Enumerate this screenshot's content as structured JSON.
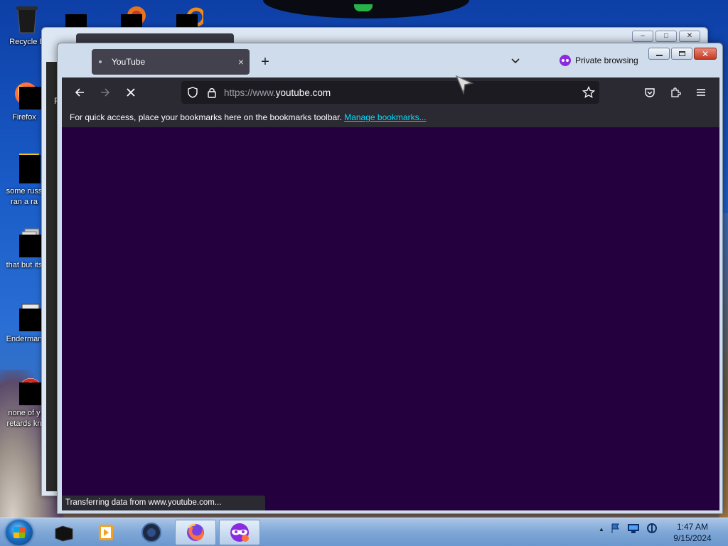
{
  "desktop": {
    "icons": [
      {
        "label": "Recycle B"
      },
      {
        "label": "Firefox"
      },
      {
        "label": "some russ\nran a ra"
      },
      {
        "label": "that but its"
      },
      {
        "label": "Enderman"
      },
      {
        "label": "none of y\nretards kn"
      }
    ],
    "back_window_char": "F"
  },
  "browser": {
    "tab": {
      "title": "YouTube",
      "close_glyph": "×"
    },
    "new_tab_glyph": "+",
    "private_label": "Private browsing",
    "url": {
      "prefix": "https://www.",
      "host": "youtube.com"
    },
    "bookmarks_bar": {
      "text": "For quick access, place your bookmarks here on the bookmarks toolbar.",
      "link": "Manage bookmarks..."
    },
    "status": "Transferring data from www.youtube.com..."
  },
  "taskbar": {
    "time": "1:47 AM",
    "date": "9/15/2024",
    "tray_arrow": "▲"
  },
  "colors": {
    "content_bg": "#25003e",
    "toolbar_bg": "#2b2a33",
    "link": "#00ddff",
    "private_mask": "#8a2be2"
  }
}
